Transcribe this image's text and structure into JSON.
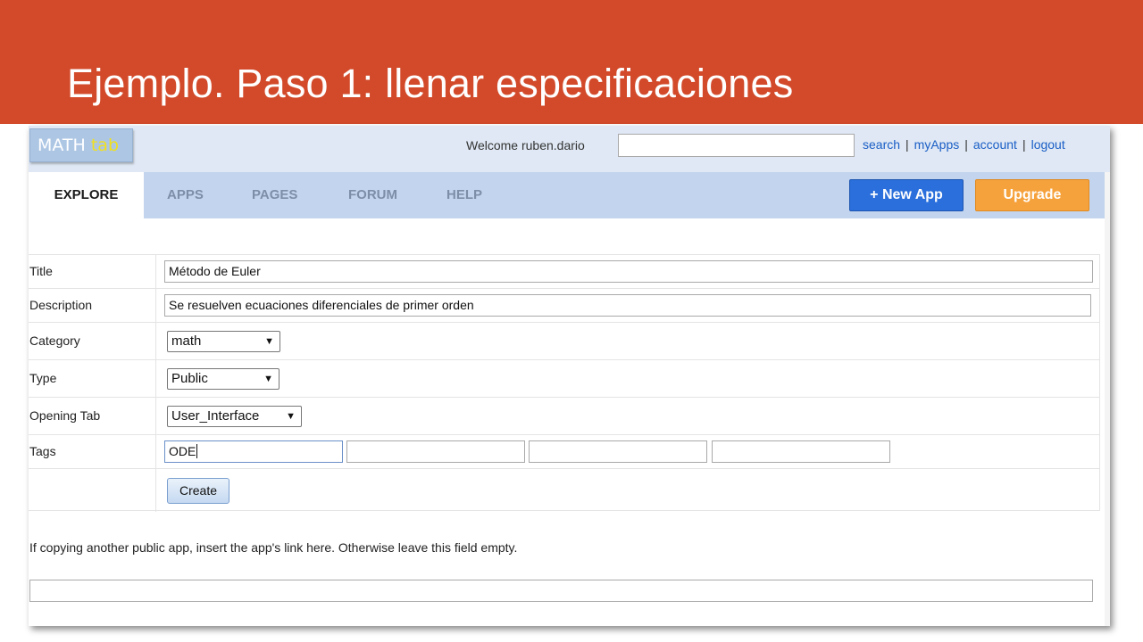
{
  "slide": {
    "title": "Ejemplo. Paso 1: llenar especificaciones",
    "header_color": "#d24a2a"
  },
  "app": {
    "logo": {
      "part1": "MATH",
      "part2": "tab"
    },
    "welcome": "Welcome ruben.dario",
    "search_value": "",
    "links": {
      "search": "search",
      "my_apps": "myApps",
      "account": "account",
      "logout": "logout",
      "separator": "|"
    },
    "nav": {
      "tabs": [
        "EXPLORE",
        "APPS",
        "PAGES",
        "FORUM",
        "HELP"
      ],
      "active": "EXPLORE",
      "new_app": "+ New App",
      "upgrade": "Upgrade"
    },
    "colors": {
      "new_app_button": "#2a6fdb",
      "upgrade_button": "#f6a23c",
      "link": "#1a5ec6"
    }
  },
  "form": {
    "title": {
      "label": "Title",
      "value": "Método de Euler"
    },
    "description": {
      "label": "Description",
      "value": "Se resuelven ecuaciones diferenciales de primer orden"
    },
    "category": {
      "label": "Category",
      "value": "math"
    },
    "type": {
      "label": "Type",
      "value": "Public"
    },
    "opening_tab": {
      "label": "Opening Tab",
      "value": "User_Interface"
    },
    "tags": {
      "label": "Tags",
      "values": [
        "ODE",
        "",
        "",
        ""
      ]
    },
    "create_button": "Create"
  },
  "copy_note": "If copying another public app, insert the app's link here. Otherwise leave this field empty.",
  "copy_link_value": ""
}
